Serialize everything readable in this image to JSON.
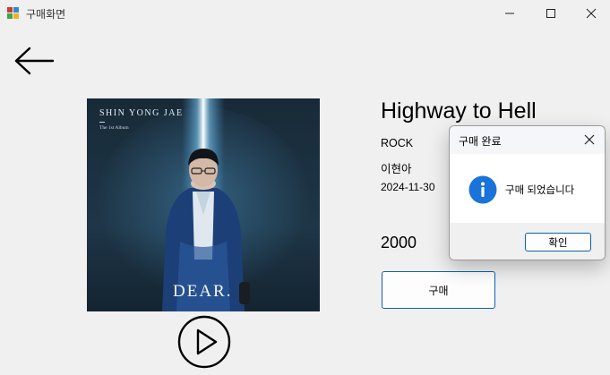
{
  "window": {
    "title": "구매화면",
    "controls": [
      "minimize-icon",
      "maximize-icon",
      "close-icon"
    ]
  },
  "nav": {
    "back_icon": "arrow-left-icon"
  },
  "album_cover": {
    "artist_text": "SHIN YONG JAE",
    "album_text": "The 1st Album",
    "title_text": "DEAR."
  },
  "player": {
    "play_icon": "play-icon"
  },
  "song": {
    "title": "Highway to Hell",
    "genre": "ROCK",
    "artist": "이현아",
    "release_date": "2024-11-30",
    "price": "2000"
  },
  "buy_button": {
    "label": "구매"
  },
  "dialog": {
    "title": "구매 완료",
    "message": "구매 되었습니다",
    "ok_label": "확인",
    "info_icon": "info-icon",
    "close_icon": "close-icon"
  },
  "colors": {
    "window_bg": "#f0f0f0",
    "accent_blue": "#0a64b0",
    "info_icon_blue": "#1a73d8",
    "cover_bg": "#1d3140"
  }
}
